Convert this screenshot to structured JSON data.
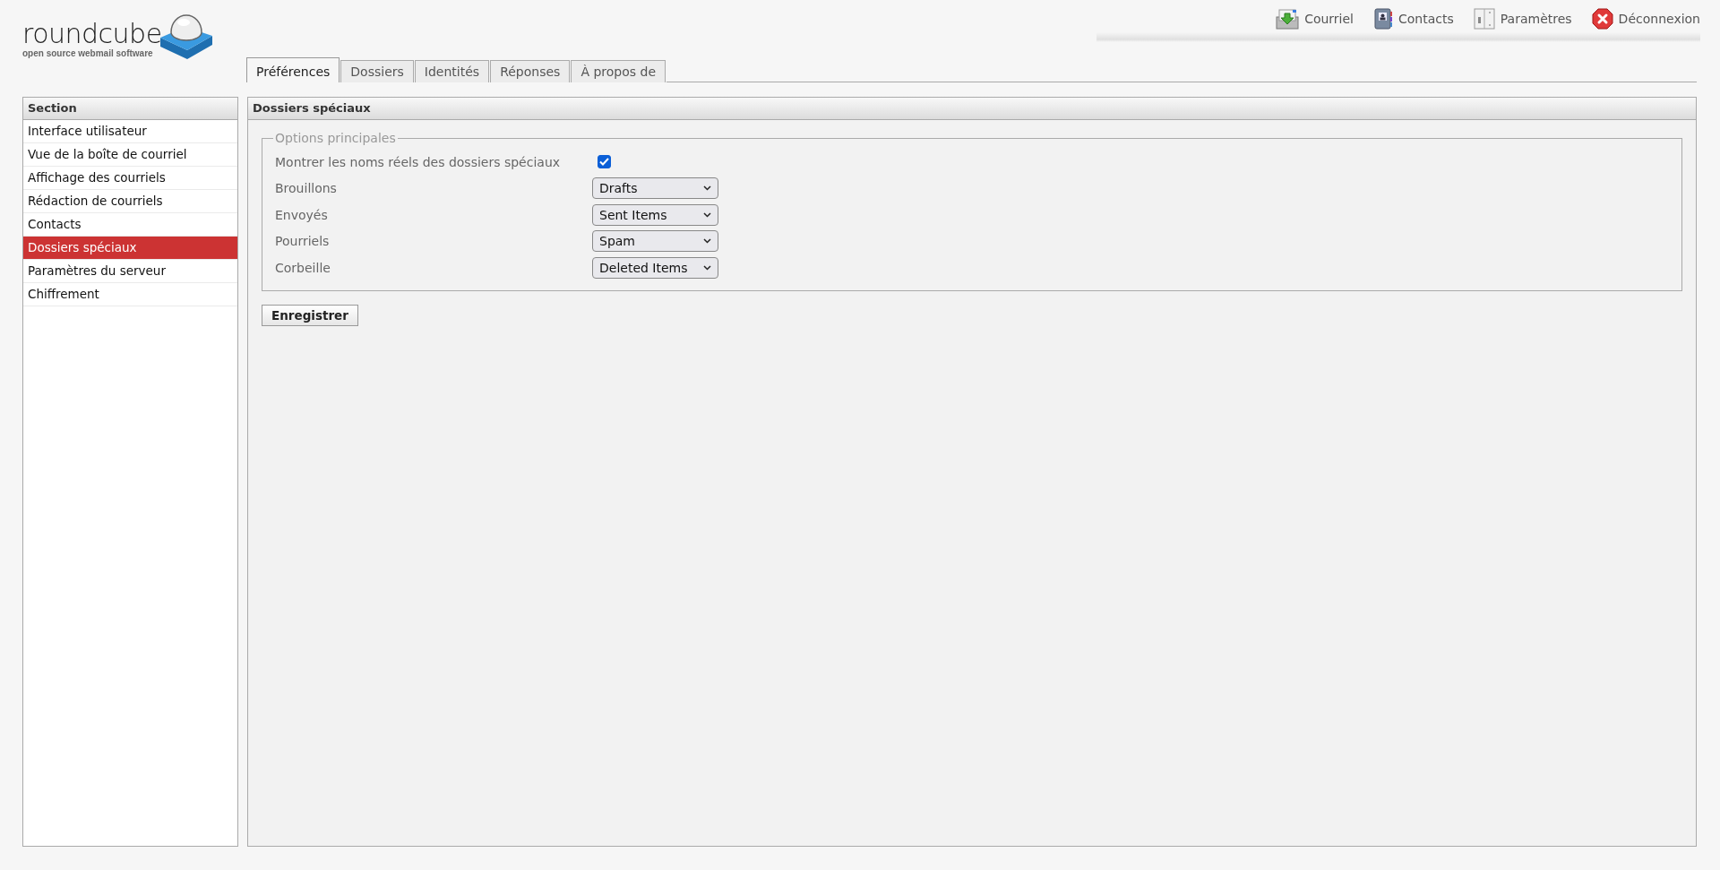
{
  "logo": {
    "name": "roundcube",
    "tagline": "open source webmail software"
  },
  "top_nav": [
    {
      "label": "Courriel",
      "kind": "mail"
    },
    {
      "label": "Contacts",
      "kind": "contacts"
    },
    {
      "label": "Paramètres",
      "kind": "settings"
    },
    {
      "label": "Déconnexion",
      "kind": "logout"
    }
  ],
  "tabs": [
    {
      "label": "Préférences",
      "selected": true
    },
    {
      "label": "Dossiers",
      "selected": false
    },
    {
      "label": "Identités",
      "selected": false
    },
    {
      "label": "Réponses",
      "selected": false
    },
    {
      "label": "À propos de",
      "selected": false
    }
  ],
  "sidebar": {
    "header": "Section",
    "items": [
      {
        "label": "Interface utilisateur",
        "selected": false
      },
      {
        "label": "Vue de la boîte de courriel",
        "selected": false
      },
      {
        "label": "Affichage des courriels",
        "selected": false
      },
      {
        "label": "Rédaction de courriels",
        "selected": false
      },
      {
        "label": "Contacts",
        "selected": false
      },
      {
        "label": "Dossiers spéciaux",
        "selected": true
      },
      {
        "label": "Paramètres du serveur",
        "selected": false
      },
      {
        "label": "Chiffrement",
        "selected": false
      }
    ]
  },
  "panel": {
    "title": "Dossiers spéciaux",
    "fieldset": {
      "legend": "Options principales",
      "rows": [
        {
          "kind": "checkbox",
          "label": "Montrer les noms réels des dossiers spéciaux",
          "checked": true
        },
        {
          "kind": "select",
          "label": "Brouillons",
          "value": "Drafts"
        },
        {
          "kind": "select",
          "label": "Envoyés",
          "value": "Sent Items"
        },
        {
          "kind": "select",
          "label": "Pourriels",
          "value": "Spam"
        },
        {
          "kind": "select",
          "label": "Corbeille",
          "value": "Deleted Items"
        }
      ]
    },
    "save_button": "Enregistrer"
  }
}
